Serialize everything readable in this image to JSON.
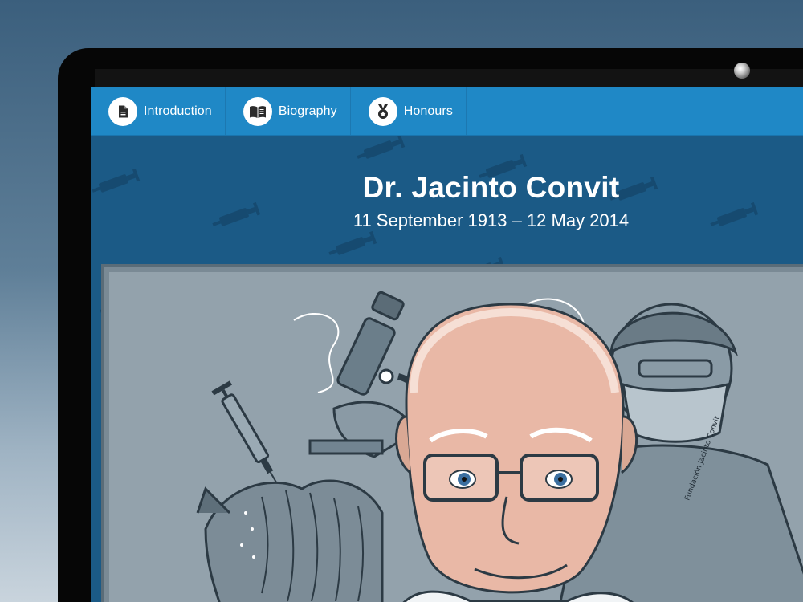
{
  "nav": {
    "items": [
      {
        "label": "Introduction",
        "icon": "document-icon"
      },
      {
        "label": "Biography",
        "icon": "open-book-icon"
      },
      {
        "label": "Honours",
        "icon": "medal-icon"
      }
    ]
  },
  "hero": {
    "title": "Dr. Jacinto Convit",
    "dates": "11 September 1913 – 12 May 2014"
  },
  "portrait": {
    "signature": "Fundación Jacinto Convit"
  },
  "colors": {
    "navbar": "#1f88c6",
    "background": "#1b5a86",
    "pattern": "#16496e",
    "text": "#ffffff"
  }
}
